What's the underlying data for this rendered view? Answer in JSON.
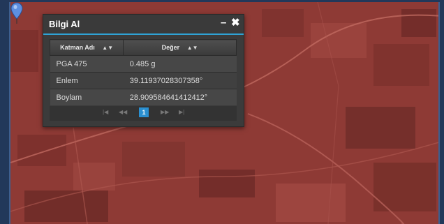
{
  "panel": {
    "title": "Bilgi Al",
    "minimize_icon": "–",
    "close_icon": "✖",
    "columns": [
      "Katman Adı",
      "Değer"
    ],
    "rows": [
      [
        "PGA 475",
        "0.485 g"
      ],
      [
        "Enlem",
        "39.11937028307358°"
      ],
      [
        "Boylam",
        "28.909584641412412°"
      ]
    ],
    "pager": {
      "first": "|◀",
      "prev": "◀◀",
      "current_page": "1",
      "next": "▶▶",
      "last": "▶|"
    }
  },
  "map": {
    "overlay_color": "#8e3a35",
    "marker_color": "#5d8fe0"
  }
}
